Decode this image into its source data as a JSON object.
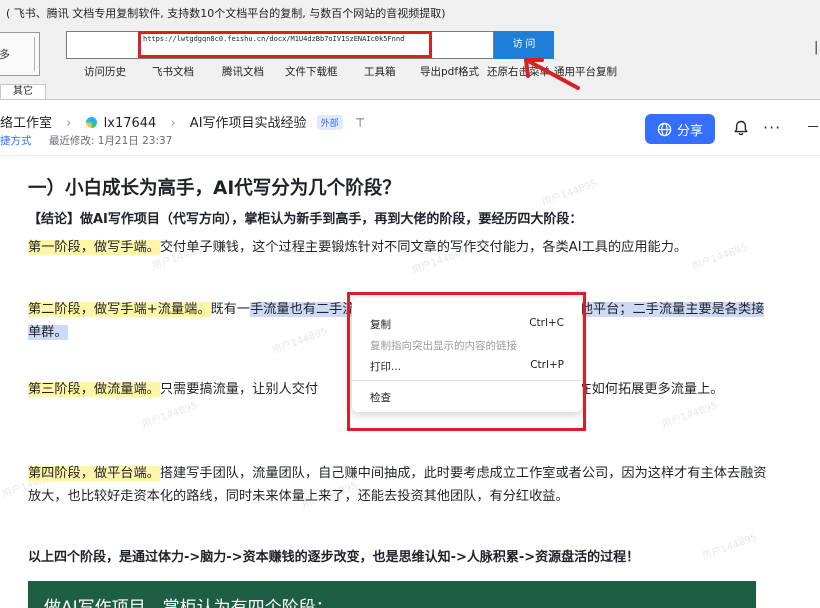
{
  "tool": {
    "title": "( 飞书、腾讯 文档专用复制软件, 支持数10个文档平台的复制, 与数百个网站的音视频提取)",
    "left_box_label": "多",
    "url_value": "https://lwtgdgqn8c0.feishu.cn/docx/M1U4dzBb7oIV1SzENAIc0k5Fnnd",
    "visit_button": "访 问",
    "menu": [
      "访问历史",
      "飞书文档",
      "腾讯文档",
      "文件下载框",
      "工具箱",
      "导出pdf格式",
      "还原右击菜单",
      "通用平台复制"
    ],
    "tab_other": "其它",
    "right_mark": "|",
    "accent_red": "#d92027",
    "accent_blue": "#1e7fd8"
  },
  "header": {
    "workspace": "络工作室",
    "user": "lx17644",
    "doc_title": "AI写作项目实战经验",
    "external_badge": "外部",
    "pin_icon": "pin-icon",
    "shortcut_label": "捷方式",
    "last_modified": "最近修改: 1月21日 23:37",
    "share_button": "分享",
    "bell_icon": "bell-icon",
    "more_icon": "more-icon",
    "share_color": "#3370ff"
  },
  "doc": {
    "heading": "一）小白成长为高手，AI代写分为几个阶段？",
    "conclusion": "【结论】做AI写作项目（代写方向），掌柜认为新手到高手，再到大佬的阶段，要经历四大阶段：",
    "stages": [
      {
        "lead": "第一阶段，做写手端。",
        "text": "交付单子赚钱，这个过程主要锻炼针对不同文章的写作交付能力，各类AI工具的应用能力。"
      },
      {
        "lead": "第二阶段，做写手端+流量端。",
        "text_a": "既有一",
        "text_sel": "手流量也有二手流量，一手流量集中考虑闲鱼，再考虑其他平台；二手流量主要是各类接单群。"
      },
      {
        "lead": "第三阶段，做流量端。",
        "text_a": "只需要搞流量，让别人交付",
        "text_b": "端，所以重点放在如何拓展更多流量上。"
      },
      {
        "lead": "第四阶段，做平台端。",
        "text": "搭建写手团队，流量团队，自己赚中间抽成，此时要考虑成立工作室或者公司，因为这样才有主体去融资放大，也比较好走资本化的路线，同时未来体量上来了，还能去投资其他团队，有分红收益。"
      }
    ],
    "summary": "以上四个阶段，是通过体力->脑力->资本赚钱的逐步改变，也是思维认知->人脉积累->资源盘活的过程！",
    "banner": "做AI写作项目，掌柜认为有四个阶段：",
    "watermark": "用户144895",
    "highlight_color": "#fff5a8",
    "selection_color": "#cdd9f5",
    "banner_color": "#1e5e42"
  },
  "context_menu": {
    "items": [
      {
        "label": "复制",
        "shortcut": "Ctrl+C",
        "enabled": true
      },
      {
        "label": "复制指向突出显示的内容的链接",
        "shortcut": "",
        "enabled": false
      },
      {
        "label": "打印...",
        "shortcut": "Ctrl+P",
        "enabled": true
      },
      {
        "label": "检查",
        "shortcut": "",
        "enabled": true
      }
    ]
  }
}
